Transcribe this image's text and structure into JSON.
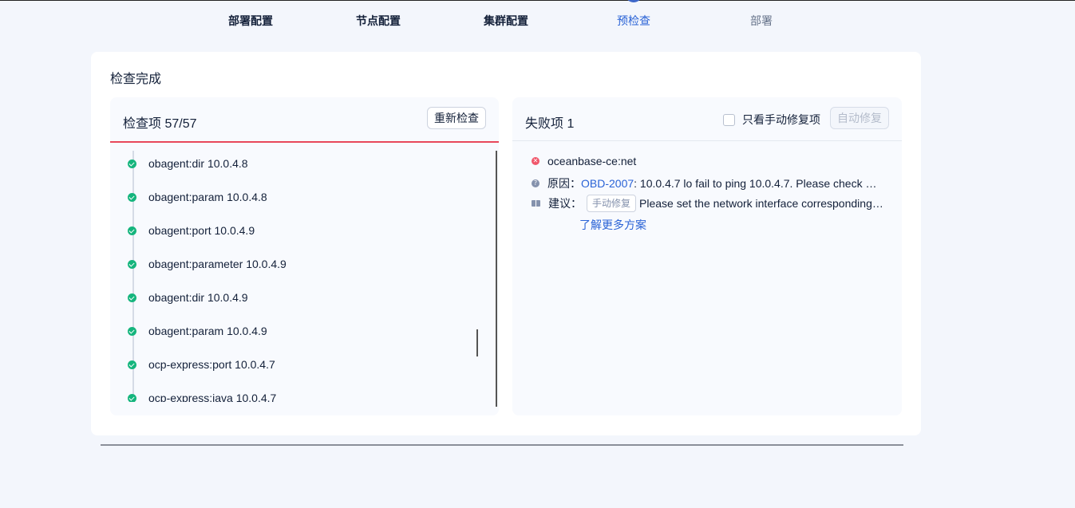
{
  "steps": [
    {
      "label": "部署配置",
      "state": "done"
    },
    {
      "label": "节点配置",
      "state": "done"
    },
    {
      "label": "集群配置",
      "state": "done"
    },
    {
      "label": "预检查",
      "state": "active"
    },
    {
      "label": "部署",
      "state": "pending"
    }
  ],
  "card": {
    "title": "检查完成"
  },
  "left_panel": {
    "title": "检查项 57/57",
    "recheck_label": "重新检查",
    "items": [
      "obagent:dir 10.0.4.8",
      "obagent:param 10.0.4.8",
      "obagent:port 10.0.4.9",
      "obagent:parameter 10.0.4.9",
      "obagent:dir 10.0.4.9",
      "obagent:param 10.0.4.9",
      "ocp-express:port 10.0.4.7",
      "ocp-express:java 10.0.4.7"
    ]
  },
  "right_panel": {
    "title": "失败项 1",
    "only_manual_label": "只看手动修复项",
    "auto_fix_label": "自动修复",
    "failure": {
      "name": "oceanbase-ce:net",
      "reason_label": "原因：",
      "reason_code": "OBD-2007",
      "reason_text": " : 10.0.4.7 lo fail to ping 10.0.4.7. Please check co...",
      "suggest_label": "建议：",
      "manual_tag": "手动修复",
      "suggest_text": "Please set the network interface corresponding t...",
      "learn_more": "了解更多方案"
    }
  },
  "colors": {
    "accent": "#2a63d6",
    "success": "#15b57d",
    "error": "#e8475a"
  },
  "icons": [
    "check-circle-icon",
    "close-circle-icon",
    "question-circle-icon",
    "book-icon"
  ]
}
